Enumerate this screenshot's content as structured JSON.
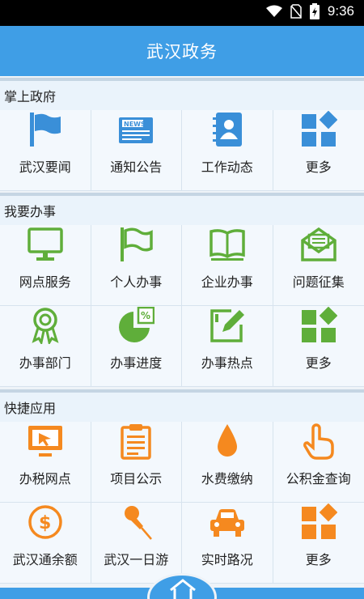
{
  "status_bar": {
    "time": "9:36",
    "icons": [
      "wifi-icon",
      "no-sim-icon",
      "battery-icon"
    ]
  },
  "title": "武汉政务",
  "sections": [
    {
      "header": "掌上政府",
      "items": [
        {
          "label": "武汉要闻",
          "icon": "flag-icon"
        },
        {
          "label": "通知公告",
          "icon": "news-icon"
        },
        {
          "label": "工作动态",
          "icon": "contacts-icon"
        },
        {
          "label": "更多",
          "icon": "more-grid-icon"
        }
      ]
    },
    {
      "header": "我要办事",
      "items": [
        {
          "label": "网点服务",
          "icon": "monitor-icon"
        },
        {
          "label": "个人办事",
          "icon": "flag-outline-icon"
        },
        {
          "label": "企业办事",
          "icon": "book-icon"
        },
        {
          "label": "问题征集",
          "icon": "mail-icon"
        },
        {
          "label": "办事部门",
          "icon": "award-icon"
        },
        {
          "label": "办事进度",
          "icon": "pie-percent-icon"
        },
        {
          "label": "办事热点",
          "icon": "edit-icon"
        },
        {
          "label": "更多",
          "icon": "more-grid-icon"
        }
      ]
    },
    {
      "header": "快捷应用",
      "items": [
        {
          "label": "办税网点",
          "icon": "screen-cursor-icon"
        },
        {
          "label": "项目公示",
          "icon": "clipboard-icon"
        },
        {
          "label": "水费缴纳",
          "icon": "water-drop-icon"
        },
        {
          "label": "公积金查询",
          "icon": "hand-pointer-icon"
        },
        {
          "label": "武汉通余额",
          "icon": "coin-icon"
        },
        {
          "label": "武汉一日游",
          "icon": "pin-icon"
        },
        {
          "label": "实时路况",
          "icon": "car-icon"
        },
        {
          "label": "更多",
          "icon": "more-grid-icon"
        }
      ]
    }
  ],
  "colors": {
    "title_bar": "#3f9ee6",
    "blue_icons": "#3a8fd8",
    "green_icons": "#5fae3a",
    "orange_icons": "#f5891f"
  }
}
